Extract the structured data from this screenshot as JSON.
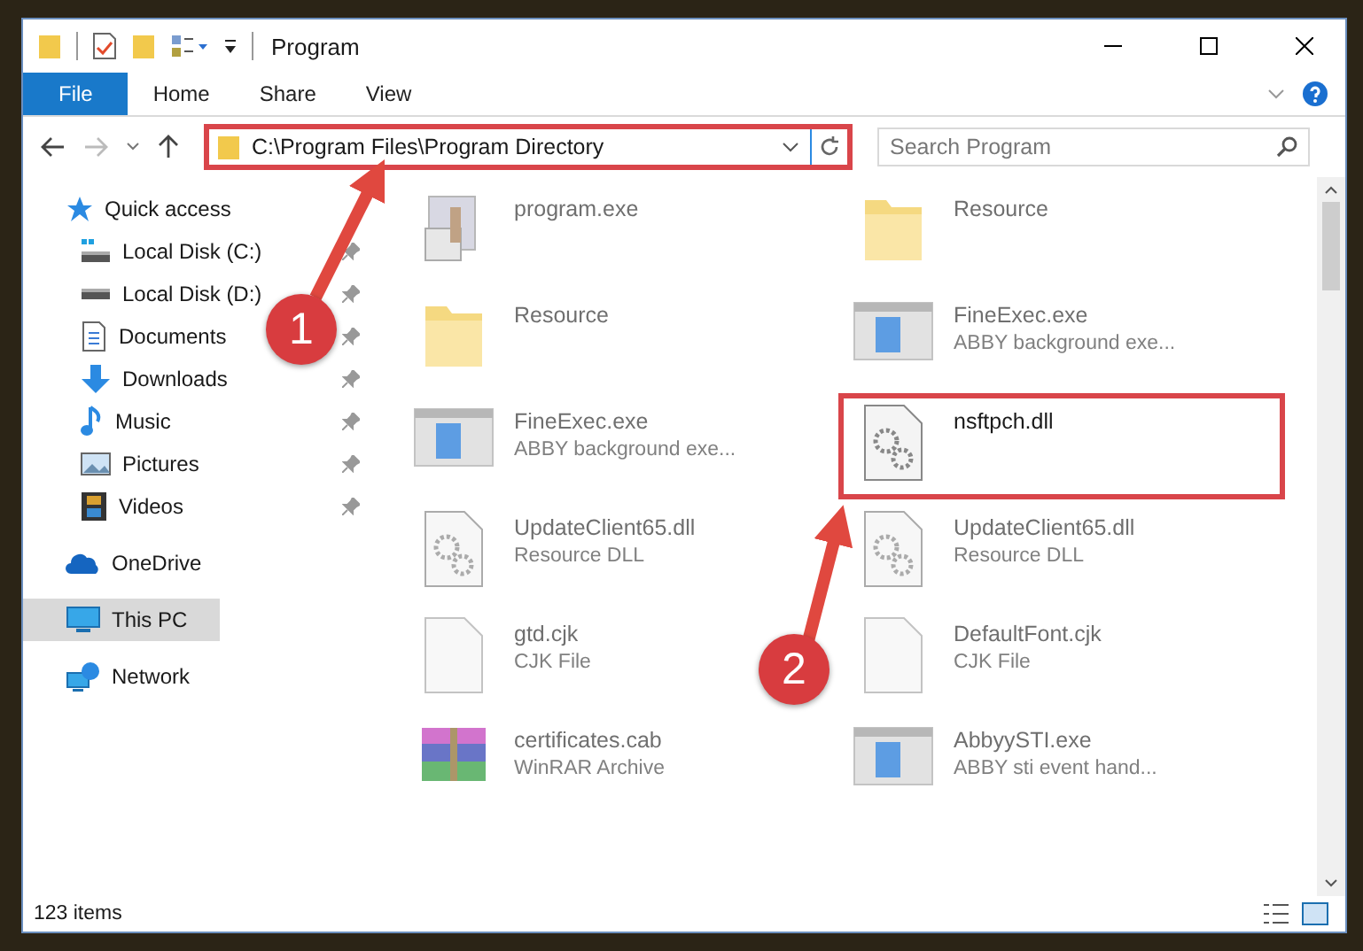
{
  "window": {
    "title": "Program"
  },
  "ribbon_tabs": [
    {
      "label": "File",
      "selected": true
    },
    {
      "label": "Home",
      "selected": false
    },
    {
      "label": "Share",
      "selected": false
    },
    {
      "label": "View",
      "selected": false
    }
  ],
  "address_bar": {
    "path": "C:\\Program Files\\Program Directory",
    "highlighted": true
  },
  "search": {
    "placeholder": "Search Program"
  },
  "navigation": [
    {
      "label": "Quick access",
      "kind": "star",
      "selected": false,
      "children": [
        {
          "label": "Local Disk (C:)",
          "kind": "windrive",
          "pinned": true,
          "selected": false
        },
        {
          "label": "Local Disk (D:)",
          "kind": "drive",
          "pinned": true,
          "selected": false
        },
        {
          "label": "Documents",
          "kind": "documents",
          "pinned": true,
          "selected": false
        },
        {
          "label": "Downloads",
          "kind": "downloads",
          "pinned": true,
          "selected": false
        },
        {
          "label": "Music",
          "kind": "music",
          "pinned": true,
          "selected": false
        },
        {
          "label": "Pictures",
          "kind": "pictures",
          "pinned": true,
          "selected": false
        },
        {
          "label": "Videos",
          "kind": "videos",
          "pinned": true,
          "selected": false
        }
      ]
    },
    {
      "label": "OneDrive",
      "kind": "cloud",
      "selected": false
    },
    {
      "label": "This PC",
      "kind": "pc",
      "selected": true
    },
    {
      "label": "Network",
      "kind": "network",
      "selected": false
    }
  ],
  "files": [
    {
      "name": "program.exe",
      "kind": "installer",
      "dimmed": true,
      "highlighted": false
    },
    {
      "name": "Resource",
      "kind": "folder",
      "dimmed": true,
      "highlighted": false
    },
    {
      "name": "Resource",
      "kind": "folder",
      "dimmed": true,
      "highlighted": false
    },
    {
      "name": "FineExec.exe",
      "description": "ABBY background exe...",
      "kind": "app",
      "dimmed": true,
      "highlighted": false
    },
    {
      "name": "FineExec.exe",
      "description": "ABBY background exe...",
      "kind": "app",
      "dimmed": true,
      "highlighted": false
    },
    {
      "name": "nsftpch.dll",
      "kind": "dll",
      "dimmed": false,
      "highlighted": true
    },
    {
      "name": "UpdateClient65.dll",
      "description": "Resource DLL",
      "kind": "dll",
      "dimmed": true,
      "highlighted": false
    },
    {
      "name": "UpdateClient65.dll",
      "description": "Resource DLL",
      "kind": "dll",
      "dimmed": true,
      "highlighted": false
    },
    {
      "name": "gtd.cjk",
      "description": "CJK File",
      "kind": "file",
      "dimmed": true,
      "highlighted": false
    },
    {
      "name": "DefaultFont.cjk",
      "description": "CJK File",
      "kind": "file",
      "dimmed": true,
      "highlighted": false
    },
    {
      "name": "certificates.cab",
      "description": "WinRAR Archive",
      "kind": "archive",
      "dimmed": true,
      "highlighted": false
    },
    {
      "name": "AbbyySTI.exe",
      "description": "ABBY sti event hand...",
      "kind": "app",
      "dimmed": true,
      "highlighted": false
    }
  ],
  "status_bar": {
    "item_count": "123 items"
  },
  "annotations": [
    {
      "label": "1"
    },
    {
      "label": "2"
    }
  ]
}
